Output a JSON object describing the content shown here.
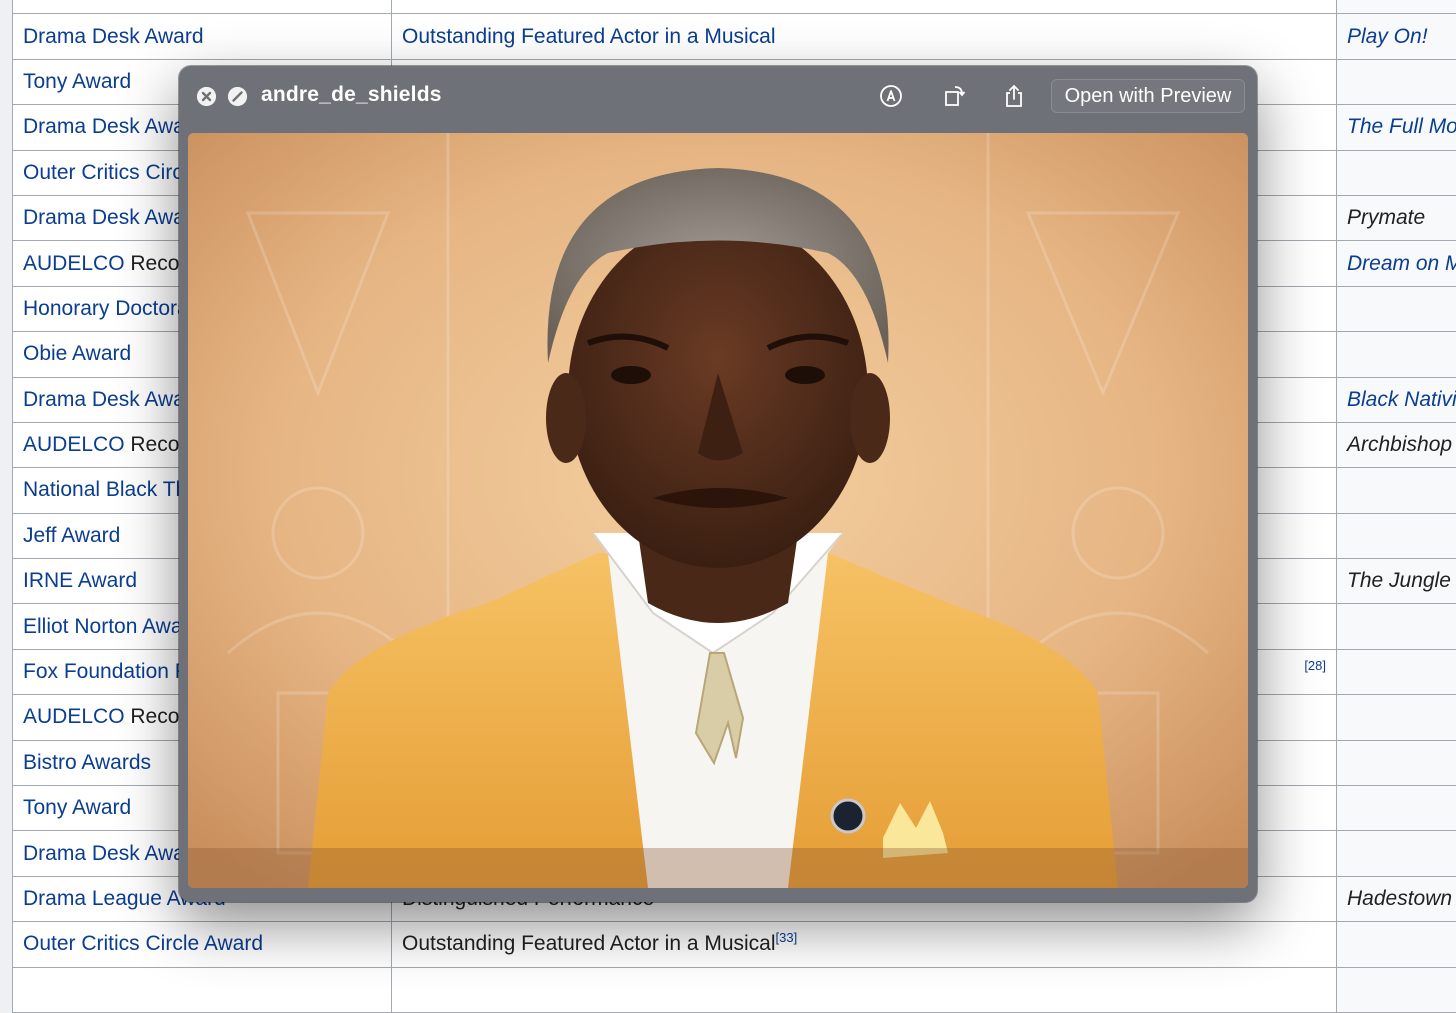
{
  "table": {
    "rows": [
      {
        "award": "",
        "award_link": true,
        "category": "",
        "category_link": false,
        "work": "",
        "work_sup": ""
      },
      {
        "award": "Drama Desk Award",
        "award_link": true,
        "category": "Outstanding Featured Actor in a Musical",
        "category_link": true,
        "work": "Play On!"
      },
      {
        "award": "Tony Award",
        "award_link": true,
        "category": "",
        "category_link": false,
        "work": ""
      },
      {
        "award": "Drama Desk Award",
        "award_link": true,
        "category": "",
        "category_link": false,
        "work": "The Full Monty"
      },
      {
        "award": "Outer Critics Circle Award",
        "award_link": true,
        "category": "",
        "category_link": false,
        "work": ""
      },
      {
        "award": "Drama Desk Award",
        "award_link": true,
        "category": "",
        "category_link": false,
        "work": "Prymate",
        "work_plain": true
      },
      {
        "award_prefix": "AUDELCO",
        "award": " Recognition Award",
        "award_link": "prefix",
        "category": "",
        "category_link": false,
        "work": "Dream on Monkey Mountain"
      },
      {
        "award": "Honorary Doctorate",
        "award_link": true,
        "category": "",
        "category_link": false,
        "work": ""
      },
      {
        "award": "Obie Award",
        "award_link": true,
        "category": "",
        "category_link": false,
        "work": ""
      },
      {
        "award": "Drama Desk Award",
        "award_link": true,
        "category": "",
        "category_link": false,
        "work": "Black Nativity"
      },
      {
        "award_prefix": "AUDELCO",
        "award": " Recognition Award",
        "award_link": "prefix",
        "category": "",
        "category_link": false,
        "work": "Archbishop Supreme",
        "work_plain": true
      },
      {
        "award": "National Black Theatre Festival",
        "award_link": true,
        "category": "",
        "category_link": false,
        "work": ""
      },
      {
        "award": "Jeff Award",
        "award_link": true,
        "category": "",
        "category_link": false,
        "work": ""
      },
      {
        "award": "IRNE Award",
        "award_link": true,
        "category": "",
        "category_link": false,
        "work": "The Jungle Book",
        "work_plain": true
      },
      {
        "award": "Elliot Norton Award",
        "award_link": true,
        "category": "",
        "category_link": false,
        "work": ""
      },
      {
        "award": "Fox Foundation Fellowship",
        "award_link": true,
        "category": "",
        "category_link": false,
        "cat_sup": "[28]",
        "work": ""
      },
      {
        "award_prefix": "AUDELCO",
        "award": " Recognition Award",
        "award_link": "prefix",
        "category": "",
        "category_link": false,
        "work": ""
      },
      {
        "award": "Bistro Awards",
        "award_link": true,
        "category": "",
        "category_link": false,
        "work": ""
      },
      {
        "award": "Tony Award",
        "award_link": true,
        "category": "",
        "category_link": false,
        "work": ""
      },
      {
        "award": "Drama Desk Award",
        "award_link": true,
        "category": "",
        "category_link": false,
        "work": ""
      },
      {
        "award": "Drama League Award",
        "award_link": true,
        "category": "Distinguished Performance",
        "category_link": false,
        "work": "Hadestown",
        "work_plain": true
      },
      {
        "award": "Outer Critics Circle Award",
        "award_link": true,
        "category": "Outstanding Featured Actor in a Musical",
        "category_link": false,
        "cat_sup": "[33]",
        "work": ""
      },
      {
        "award": "",
        "award_link": true,
        "category": "",
        "category_link": false,
        "work": ""
      }
    ]
  },
  "quicklook": {
    "title": "andre_de_shields",
    "open_button_label": "Open with Preview"
  },
  "colors": {
    "link": "#0b3d91",
    "window": "#6f7178",
    "jacket": "#f2b74f"
  }
}
